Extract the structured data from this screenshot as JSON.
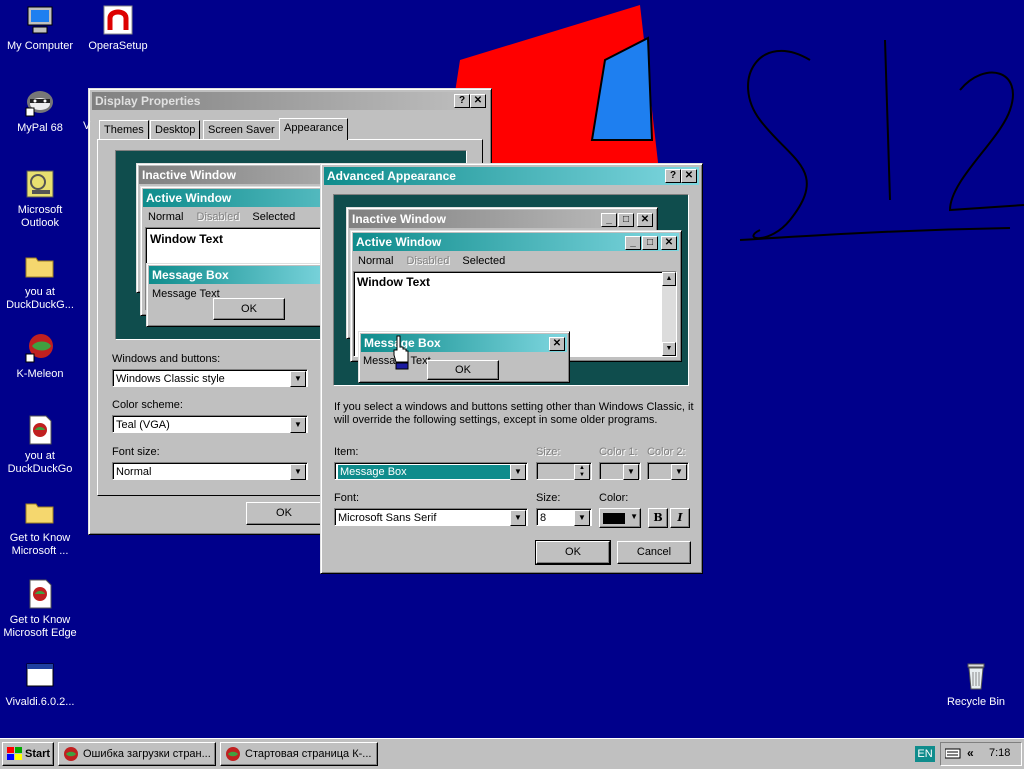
{
  "desktop": {
    "icons": [
      {
        "label": "My Computer",
        "icon": "computer-icon"
      },
      {
        "label": "OperaSetup",
        "icon": "opera-icon"
      },
      {
        "label": "MyPal 68",
        "icon": "mypal-icon"
      },
      {
        "label": "Microsoft Outlook",
        "icon": "outlook-icon"
      },
      {
        "label": "you at DuckDuckG...",
        "icon": "folder-icon"
      },
      {
        "label": "K-Meleon",
        "icon": "kmeleon-icon"
      },
      {
        "label": "you at DuckDuckGo",
        "icon": "document-icon"
      },
      {
        "label": "Get to Know Microsoft ...",
        "icon": "folder-icon"
      },
      {
        "label": "Get to Know Microsoft Edge",
        "icon": "document-icon"
      },
      {
        "label": "Vivaldi.6.0.2...",
        "icon": "window-icon"
      },
      {
        "label": "Recycle Bin",
        "icon": "recycle-bin-icon"
      }
    ],
    "partial_label": "V"
  },
  "display_properties": {
    "title": "Display Properties",
    "help_btn": "?",
    "close_btn": "✕",
    "tabs": [
      "Themes",
      "Desktop",
      "Screen Saver",
      "Appearance"
    ],
    "preview": {
      "inactive_title": "Inactive Window",
      "active_title": "Active Window",
      "menu": [
        "Normal",
        "Disabled",
        "Selected"
      ],
      "window_text": "Window Text",
      "message_box": "Message Box",
      "message_text": "Message Text",
      "ok": "OK"
    },
    "windows_buttons_label": "Windows and buttons:",
    "windows_buttons_value": "Windows Classic style",
    "color_scheme_label": "Color scheme:",
    "color_scheme_value": "Teal (VGA)",
    "font_size_label": "Font size:",
    "font_size_value": "Normal",
    "ok": "OK"
  },
  "advanced": {
    "title": "Advanced Appearance",
    "help_btn": "?",
    "close_btn": "✕",
    "preview": {
      "inactive_title": "Inactive Window",
      "active_title": "Active Window",
      "menu": [
        "Normal",
        "Disabled",
        "Selected"
      ],
      "window_text": "Window Text",
      "message_box": "Message Box",
      "message_text": "Message Text",
      "ok": "OK"
    },
    "info": "If you select a windows and buttons setting other than Windows Classic, it will override the following settings, except in some older programs.",
    "item_label": "Item:",
    "item_value": "Message Box",
    "size_label": "Size:",
    "color1_label": "Color 1:",
    "color2_label": "Color 2:",
    "font_label": "Font:",
    "font_value": "Microsoft Sans Serif",
    "font_size_label": "Size:",
    "font_size_value": "8",
    "font_color_label": "Color:",
    "bold": "B",
    "italic": "I",
    "ok": "OK",
    "cancel": "Cancel"
  },
  "taskbar": {
    "start": "Start",
    "tasks": [
      "Ошибка загрузки стран...",
      "Стартовая страница К-..."
    ],
    "language": "EN",
    "clock": "7:18",
    "chevron": "«"
  },
  "colors": {
    "desktop": "#00008b",
    "active_title_start": "#0f8c8c",
    "active_title_end": "#7fd7e0",
    "preview_bg": "#0f4d4d",
    "selection": "#0f8c8c"
  }
}
